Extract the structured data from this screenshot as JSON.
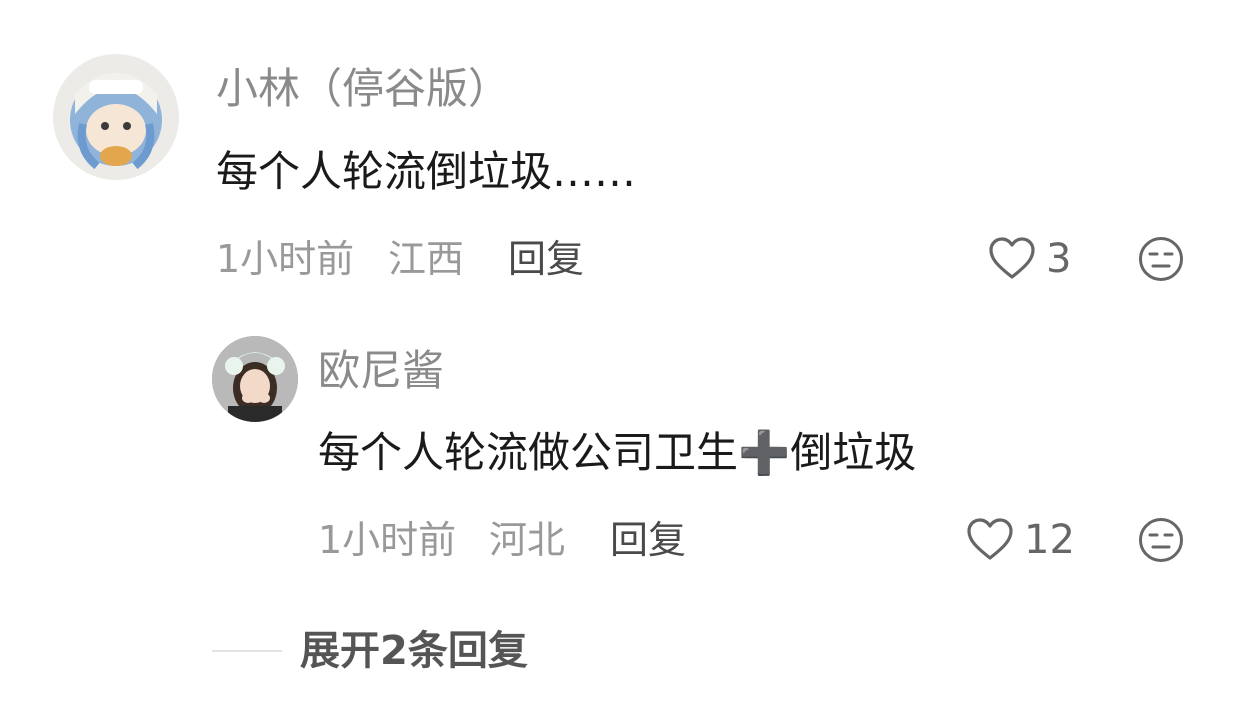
{
  "comment": {
    "username": "小林（停谷版）",
    "text": "每个人轮流倒垃圾……",
    "time": "1小时前",
    "location": "江西",
    "reply_label": "回复",
    "like_count": "3",
    "like_icon": "heart-outline",
    "dislike_icon": "meh-face"
  },
  "reply": {
    "username": "欧尼酱",
    "text": "每个人轮流做公司卫生➕倒垃圾",
    "time": "1小时前",
    "location": "河北",
    "reply_label": "回复",
    "like_count": "12",
    "like_icon": "heart-outline",
    "dislike_icon": "meh-face"
  },
  "expand_replies_label": "展开2条回复",
  "colors": {
    "username": "#8a8a8a",
    "text": "#1a1a1a",
    "meta": "#999999",
    "icon": "#666666"
  }
}
